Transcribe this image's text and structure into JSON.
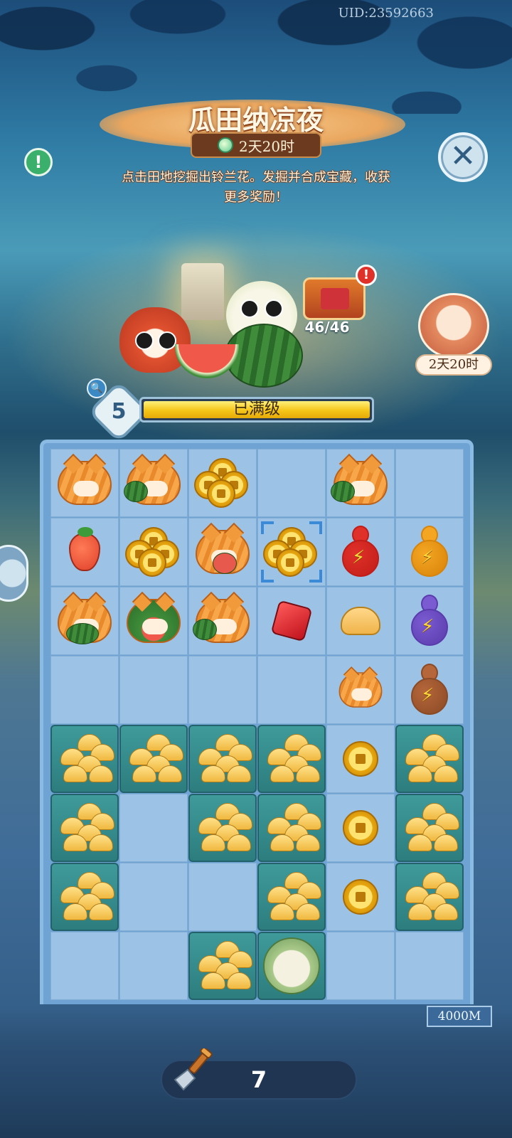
{
  "header": {
    "uid": "UID:23592663",
    "title": "瓜田纳凉夜",
    "timer": "2天20时",
    "description": "点击田地挖掘出铃兰花。发掘并合成宝藏，收获更多奖励！"
  },
  "buttons": {
    "info_icon": "!",
    "close_icon": "✕"
  },
  "collection": {
    "count": "46/46",
    "alert": "!"
  },
  "side_event": {
    "timer": "2天20时"
  },
  "level": {
    "number": "5",
    "status": "已满级",
    "progress": 1.0
  },
  "board": {
    "columns": 6,
    "rows": 8,
    "cells": [
      [
        "cat",
        "cat-melon",
        "coins",
        "empty",
        "cat-melon-hug",
        "empty"
      ],
      [
        "strawberry",
        "coin-pile",
        "cat-shell",
        "coin-pile-selected",
        "gourd-red",
        "gourd-orange"
      ],
      [
        "cat-turtle",
        "cat-melon-umbrella",
        "cat-melon-hug",
        "gem-red",
        "bun",
        "gourd-purple"
      ],
      [
        "empty",
        "empty",
        "empty",
        "empty",
        "cat-sleep",
        "gourd-brown"
      ],
      [
        "covered",
        "covered",
        "covered",
        "covered",
        "coin",
        "covered"
      ],
      [
        "covered",
        "empty",
        "covered",
        "covered",
        "coin",
        "covered"
      ],
      [
        "covered",
        "empty",
        "empty",
        "covered",
        "coin",
        "covered"
      ],
      [
        "empty",
        "empty",
        "covered",
        "digger",
        "empty",
        "empty"
      ]
    ]
  },
  "depth": "4000M",
  "shovels": {
    "count": "7"
  },
  "colors": {
    "accent_gold": "#f5c518",
    "board_bg": "#6ea3d3",
    "covered_tile": "#2d7d7e",
    "title_text": "#fff7e6"
  }
}
